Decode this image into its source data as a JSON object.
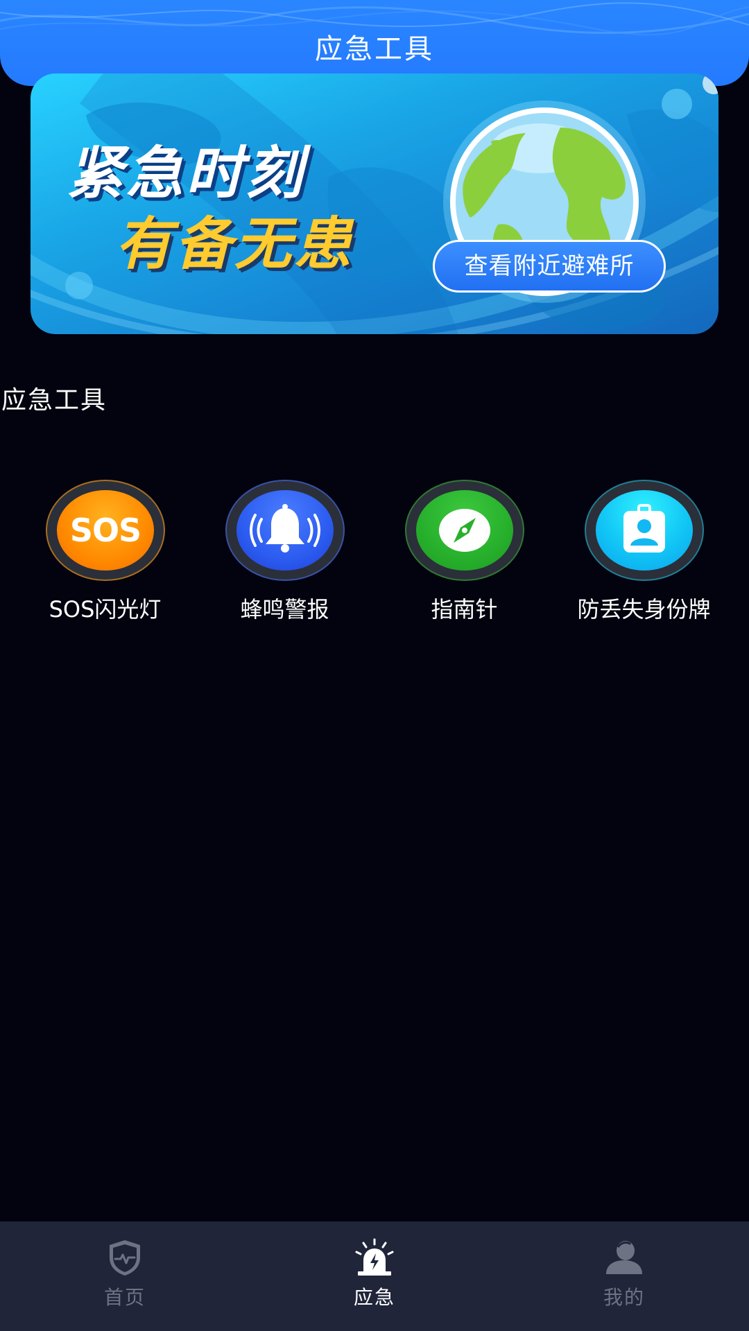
{
  "header": {
    "title": "应急工具"
  },
  "banner": {
    "slogan_line1": "紧急时刻",
    "slogan_line2": "有备无患",
    "shelter_button_label": "查看附近避难所"
  },
  "section": {
    "title": "应急工具"
  },
  "tools": [
    {
      "label": "SOS闪光灯",
      "icon": "sos-icon",
      "color": "#ff8a00"
    },
    {
      "label": "蜂鸣警报",
      "icon": "bell-icon",
      "color": "#2c5cf0"
    },
    {
      "label": "指南针",
      "icon": "compass-icon",
      "color": "#27b02c"
    },
    {
      "label": "防丢失身份牌",
      "icon": "id-badge-icon",
      "color": "#12b8f2"
    }
  ],
  "tabbar": {
    "items": [
      {
        "label": "首页",
        "icon": "shield-heartbeat-icon",
        "active": false
      },
      {
        "label": "应急",
        "icon": "siren-icon",
        "active": true
      },
      {
        "label": "我的",
        "icon": "user-icon",
        "active": false
      }
    ]
  },
  "colors": {
    "background": "#03030f",
    "header": "#247aff",
    "accent_yellow": "#ffcb2e",
    "tab_inactive": "#6e7383"
  }
}
